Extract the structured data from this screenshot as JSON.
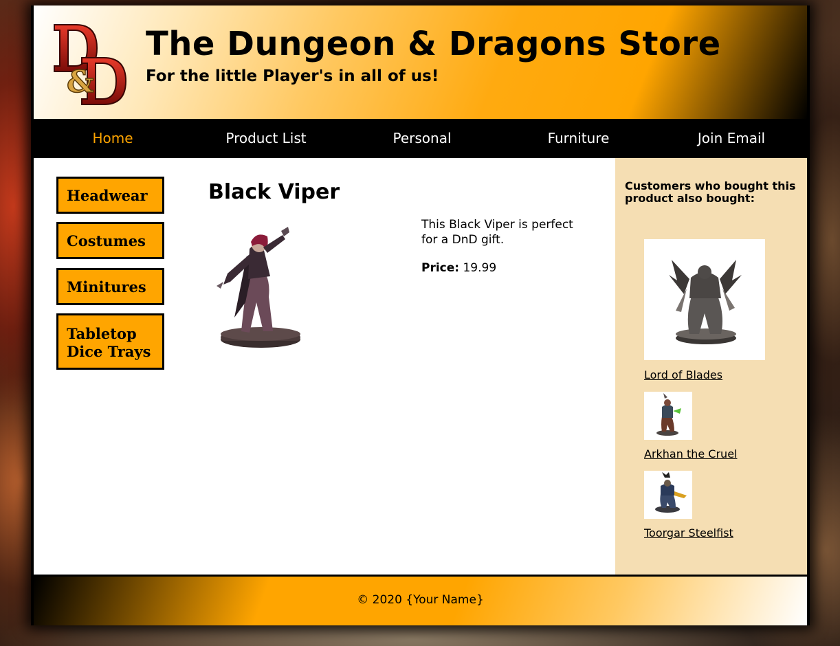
{
  "header": {
    "title": "The Dungeon & Dragons Store",
    "tagline": "For the little Player's in all of us!"
  },
  "nav": [
    {
      "label": "Home",
      "active": true
    },
    {
      "label": "Product List",
      "active": false
    },
    {
      "label": "Personal",
      "active": false
    },
    {
      "label": "Furniture",
      "active": false
    },
    {
      "label": "Join Email",
      "active": false
    }
  ],
  "sidebar": [
    {
      "label": "Headwear"
    },
    {
      "label": "Costumes"
    },
    {
      "label": "Minitures"
    },
    {
      "label": "Tabletop Dice Trays"
    }
  ],
  "product": {
    "title": "Black Viper",
    "description": "This Black Viper is perfect for a DnD gift.",
    "price_label": "Price:",
    "price_value": "19.99"
  },
  "related": {
    "heading": "Customers who bought this product also bought:",
    "items": [
      {
        "name": "Lord of Blades"
      },
      {
        "name": "Arkhan the Cruel"
      },
      {
        "name": "Toorgar Steelfist"
      }
    ]
  },
  "footer": {
    "text": "© 2020 {Your Name}"
  },
  "colors": {
    "accent": "#ffa500",
    "sidebar_bg": "#f5deb3",
    "nav_bg": "#000000"
  }
}
